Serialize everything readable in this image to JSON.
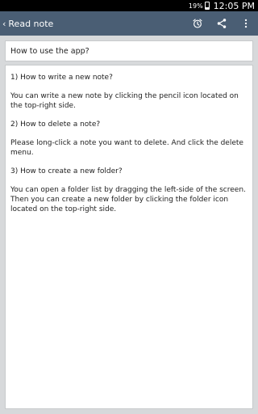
{
  "status_bar": {
    "battery": "19%",
    "time": "12:05 PM"
  },
  "app_bar": {
    "back_label": "Read note",
    "actions": [
      "alarm-icon",
      "share-icon",
      "more-vert-icon"
    ]
  },
  "note": {
    "title": "How to use the app?",
    "body": [
      "1) How to write a new note?",
      "You can write a new note by clicking the pencil icon located on the top-right side.",
      "2) How to delete a note?",
      "Please long-click a note you want to delete. And click the delete menu.",
      "3) How to create a new folder?",
      "You can open a folder list by dragging the left-side of the screen. Then you can create a new folder by clicking the folder icon located on the top-right side."
    ]
  },
  "colors": {
    "app_bar": "#4a5e74",
    "background": "#d7d9db"
  }
}
